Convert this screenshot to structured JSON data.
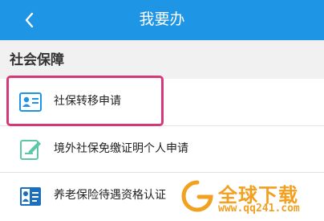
{
  "header": {
    "title": "我要办",
    "back_icon": "chevron-left-icon",
    "color": "#1f95e6"
  },
  "section": {
    "title": "社会保障"
  },
  "items": [
    {
      "label": "社保转移申请",
      "icon": "id-card-icon"
    },
    {
      "label": "境外社保免缴证明个人申请",
      "icon": "edit-document-icon"
    },
    {
      "label": "养老保险待遇资格认证",
      "icon": "person-card-icon"
    }
  ],
  "highlight_color": "#d43a7a",
  "watermark": {
    "text": "全球下载",
    "url": "www.qq241.com",
    "color": "#f2a020"
  }
}
